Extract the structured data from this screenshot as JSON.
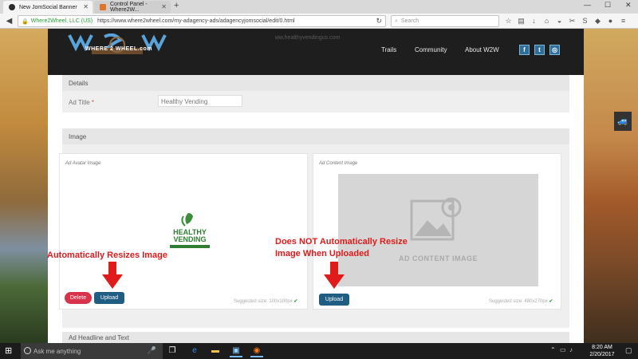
{
  "browser": {
    "tabs": [
      {
        "label": "New JomSocial Banner",
        "active": true
      },
      {
        "label": "Control Panel - Where2W...",
        "active": false
      }
    ],
    "new_tab_label": "+",
    "url_site_identity": "Where2Wheel, LLC (US)",
    "url": "https://www.where2wheel.com/my-adagency-ads/adagencyjomsocial/edit/0.html",
    "search_placeholder": "Search",
    "window_controls": {
      "minimize": "—",
      "maximize": "☐",
      "close": "✕"
    }
  },
  "site": {
    "logo_text": "WHERE 2 WHEEL.com",
    "ghost_url": "ww.healthyvendingus.com",
    "nav": [
      "Trails",
      "Community",
      "About W2W"
    ],
    "social": [
      "f",
      "t",
      "◎"
    ]
  },
  "details_panel": {
    "heading": "Details",
    "ad_title_label": "Ad Title",
    "required_marker": "*",
    "ad_title_value": "Healthy Vending"
  },
  "image_panel": {
    "heading": "Image",
    "avatar": {
      "label": "Ad Avatar Image",
      "logo_word1": "HEALTHY",
      "logo_word2": "VENDING",
      "delete_label": "Delete",
      "upload_label": "Upload",
      "suggested": "Suggested size: 100x100px"
    },
    "content": {
      "label": "Ad Content Image",
      "placeholder_text": "AD CONTENT IMAGE",
      "upload_label": "Upload",
      "suggested": "Suggested size: 480x270px"
    }
  },
  "next_panel": {
    "heading": "Ad Headline and Text"
  },
  "annotations": {
    "left": "Automatically Resizes Image",
    "right_line1": "Does NOT Automatically Resize",
    "right_line2": "Image When Uploaded"
  },
  "taskbar": {
    "search_placeholder": "Ask me anything",
    "time": "8:20 AM",
    "date": "2/20/2017"
  },
  "colors": {
    "annotation": "#e01b1b",
    "upload_button": "#1f5d82",
    "delete_button": "#d8334a",
    "header_bg": "#1e1e1e"
  }
}
